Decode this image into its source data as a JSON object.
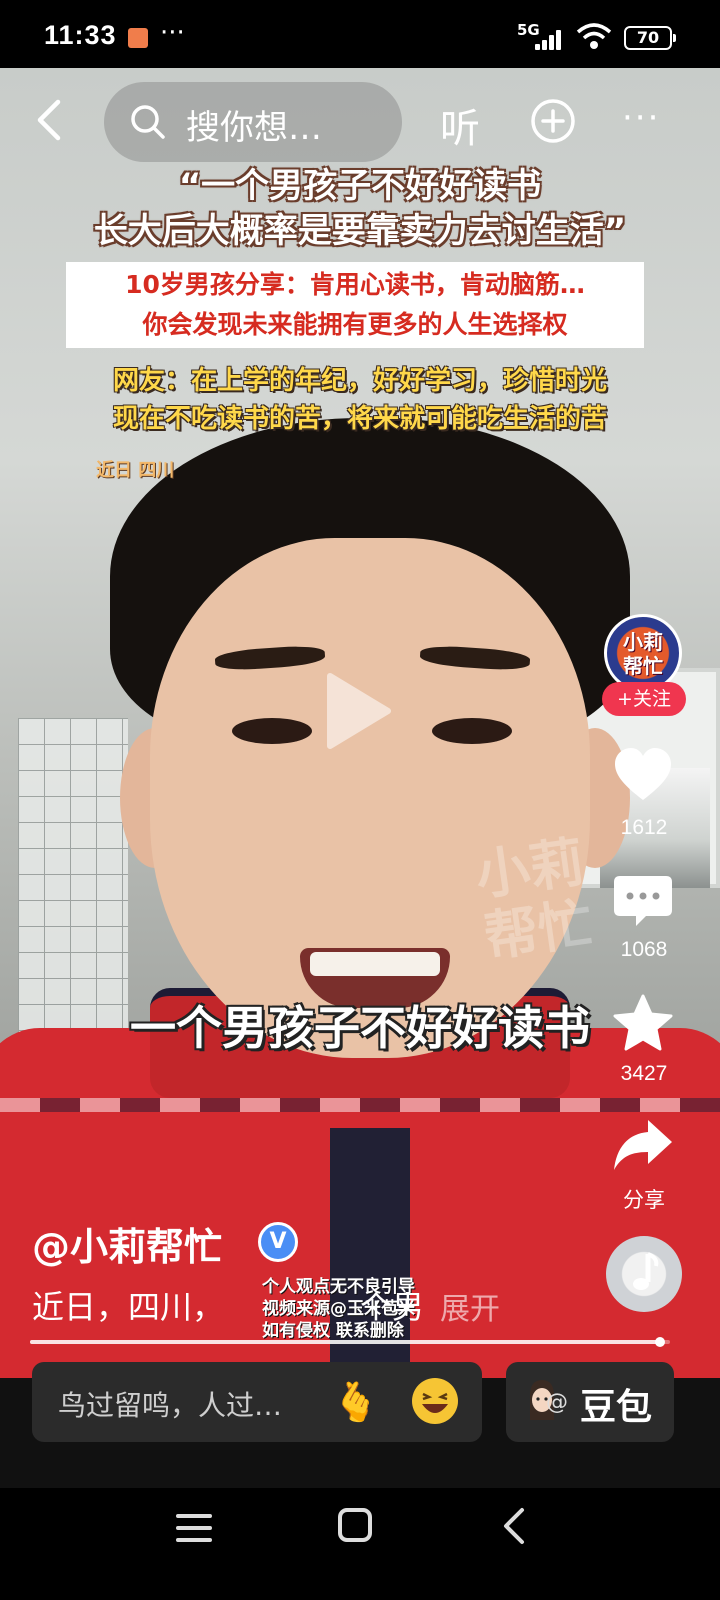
{
  "status_bar": {
    "time": "11:33",
    "dots": "···",
    "network": "5G",
    "battery": "70"
  },
  "top_nav": {
    "search_placeholder": "搜你想…",
    "listen_label": "听",
    "more_label": "···"
  },
  "overlay": {
    "headline_line1": "“一个男孩子不好好读书",
    "headline_line2": "长大后大概率是要靠卖力去讨生活”",
    "red_box_line1": "10岁男孩分享：肯用心读书，肯动脑筋…",
    "red_box_line2": "你会发现未来能拥有更多的人生选择权",
    "yellow_line1": "网友：在上学的年纪，好好学习，珍惜时光",
    "yellow_line2": "现在不吃读书的苦，将来就可能吃生活的苦",
    "location_tag": "近日 四川",
    "subtitle": "一个男孩子不好好读书",
    "watermark_line1": "小莉",
    "watermark_line2": "帮忙"
  },
  "right_rail": {
    "avatar_text_line1": "小莉",
    "avatar_text_line2": "帮忙",
    "follow_label": "+关注",
    "like_count": "1612",
    "comment_count": "1068",
    "favorite_count": "3427",
    "share_label": "分享"
  },
  "post": {
    "author": "@小莉帮忙",
    "verified_mark": "V",
    "description": "近日，四川，",
    "description_tail": "个男",
    "expand_label": "展开",
    "credit_line1": "个人观点无不良引导",
    "credit_line2": "视频来源@玉米苞米",
    "credit_line3": "如有侵权 联系删除",
    "progress": 0.985
  },
  "bottom": {
    "comment_placeholder": "鸟过留鸣，人过…",
    "heart_hand_glyph": "🫰",
    "doubao_label": "豆包",
    "doubao_prefix": "@"
  },
  "colors": {
    "follow": "#f0364f",
    "verified": "#4a8ef5",
    "headline_outline": "#6b3e2d",
    "red_text": "#d62b20",
    "yellow_text": "#ffd84a"
  }
}
